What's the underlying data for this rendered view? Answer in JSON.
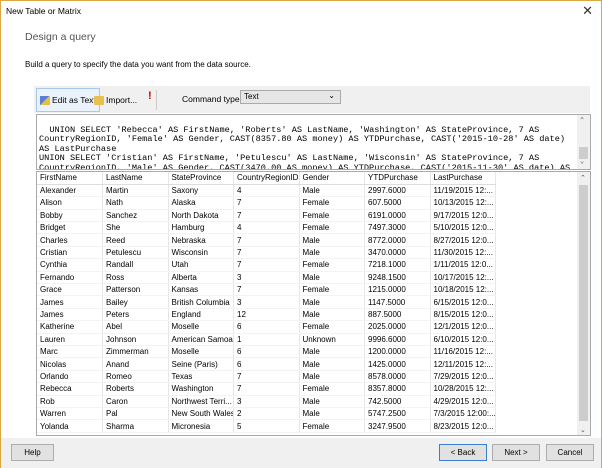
{
  "window": {
    "title": "New Table or Matrix"
  },
  "header": {
    "title": "Design a query",
    "instruction": "Build a query to specify the data you want from the data source."
  },
  "toolbar": {
    "edit_as_text": "Edit as Text",
    "import": "Import...",
    "run_icon": "!",
    "command_type_label": "Command type:",
    "command_type_value": "Text"
  },
  "query": {
    "text": "UNION SELECT 'Rebecca' AS FirstName, 'Roberts' AS LastName, 'Washington' AS StateProvince, 7 AS\nCountryRegionID, 'Female' AS Gender, CAST(8357.80 AS money) AS YTDPurchase, CAST('2015-10-28' AS date)\nAS LastPurchase\nUNION SELECT 'Cristian' AS FirstName, 'Petulescu' AS LastName, 'Wisconsin' AS StateProvince, 7 AS\nCountryRegionID, 'Male' AS Gender, CAST(3470.00 AS money) AS YTDPurchase, CAST('2015-11-30' AS date) AS"
  },
  "results": {
    "columns": [
      "FirstName",
      "LastName",
      "StateProvince",
      "CountryRegionID",
      "Gender",
      "YTDPurchase",
      "LastPurchase"
    ],
    "rows": [
      [
        "Alexander",
        "Martin",
        "Saxony",
        "4",
        "Male",
        "2997.6000",
        "11/19/2015 12:..."
      ],
      [
        "Alison",
        "Nath",
        "Alaska",
        "7",
        "Female",
        "607.5000",
        "10/13/2015 12:..."
      ],
      [
        "Bobby",
        "Sanchez",
        "North Dakota",
        "7",
        "Female",
        "6191.0000",
        "9/17/2015 12:0..."
      ],
      [
        "Bridget",
        "She",
        "Hamburg",
        "4",
        "Female",
        "7497.3000",
        "5/10/2015 12:0..."
      ],
      [
        "Charles",
        "Reed",
        "Nebraska",
        "7",
        "Male",
        "8772.0000",
        "8/27/2015 12:0..."
      ],
      [
        "Cristian",
        "Petulescu",
        "Wisconsin",
        "7",
        "Male",
        "3470.0000",
        "11/30/2015 12:..."
      ],
      [
        "Cynthia",
        "Randall",
        "Utah",
        "7",
        "Female",
        "7218.1000",
        "1/11/2015 12:0..."
      ],
      [
        "Fernando",
        "Ross",
        "Alberta",
        "3",
        "Male",
        "9248.1500",
        "10/17/2015 12:..."
      ],
      [
        "Grace",
        "Patterson",
        "Kansas",
        "7",
        "Female",
        "1215.0000",
        "10/18/2015 12:..."
      ],
      [
        "James",
        "Bailey",
        "British Columbia",
        "3",
        "Male",
        "1147.5000",
        "6/15/2015 12:0..."
      ],
      [
        "James",
        "Peters",
        "England",
        "12",
        "Male",
        "887.5000",
        "8/15/2015 12:0..."
      ],
      [
        "Katherine",
        "Abel",
        "Moselle",
        "6",
        "Female",
        "2025.0000",
        "12/1/2015 12:0..."
      ],
      [
        "Lauren",
        "Johnson",
        "American Samoa",
        "1",
        "Unknown",
        "9996.6000",
        "6/10/2015 12:0..."
      ],
      [
        "Marc",
        "Zimmerman",
        "Moselle",
        "6",
        "Male",
        "1200.0000",
        "11/16/2015 12:..."
      ],
      [
        "Nicolas",
        "Anand",
        "Seine (Paris)",
        "6",
        "Male",
        "1425.0000",
        "12/11/2015 12:..."
      ],
      [
        "Orlando",
        "Romeo",
        "Texas",
        "7",
        "Male",
        "8578.0000",
        "7/29/2015 12:0..."
      ],
      [
        "Rebecca",
        "Roberts",
        "Washington",
        "7",
        "Female",
        "8357.8000",
        "10/28/2015 12:..."
      ],
      [
        "Rob",
        "Caron",
        "Northwest Terri...",
        "3",
        "Male",
        "742.5000",
        "4/29/2015 12:0..."
      ],
      [
        "Warren",
        "Pal",
        "New South Wales",
        "2",
        "Male",
        "5747.2500",
        "7/3/2015 12:00:..."
      ],
      [
        "Yolanda",
        "Sharma",
        "Micronesia",
        "5",
        "Female",
        "3247.9500",
        "8/23/2015 12:0..."
      ]
    ]
  },
  "footer": {
    "help": "Help",
    "back": "< Back",
    "next": "Next >",
    "cancel": "Cancel"
  },
  "colors": {
    "window_border": "#d8a940",
    "default_button_border": "#3c7fd0",
    "run_icon": "#cc0000"
  }
}
